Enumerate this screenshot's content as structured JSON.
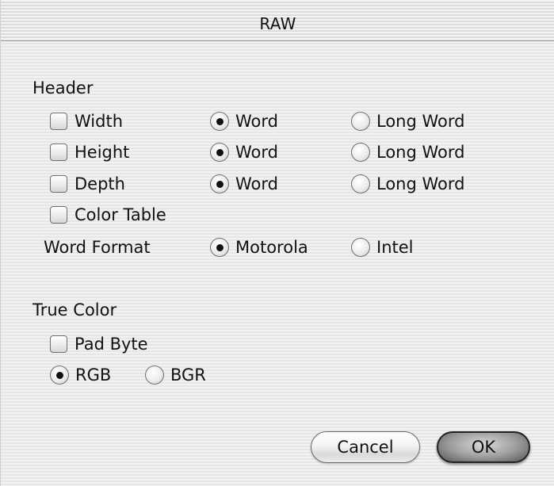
{
  "window": {
    "title": "RAW"
  },
  "header": {
    "section_label": "Header",
    "rows": [
      {
        "checkbox_label": "Width",
        "checked": false,
        "word_label": "Word",
        "long_word_label": "Long Word",
        "selected": "word"
      },
      {
        "checkbox_label": "Height",
        "checked": false,
        "word_label": "Word",
        "long_word_label": "Long Word",
        "selected": "word"
      },
      {
        "checkbox_label": "Depth",
        "checked": false,
        "word_label": "Word",
        "long_word_label": "Long Word",
        "selected": "word"
      }
    ],
    "color_table_label": "Color Table",
    "color_table_checked": false,
    "word_format_label": "Word Format",
    "motorola_label": "Motorola",
    "intel_label": "Intel",
    "word_format_selected": "motorola"
  },
  "true_color": {
    "section_label": "True Color",
    "pad_byte_label": "Pad Byte",
    "pad_byte_checked": false,
    "rgb_label": "RGB",
    "bgr_label": "BGR",
    "selected": "rgb"
  },
  "buttons": {
    "cancel_label": "Cancel",
    "ok_label": "OK"
  }
}
